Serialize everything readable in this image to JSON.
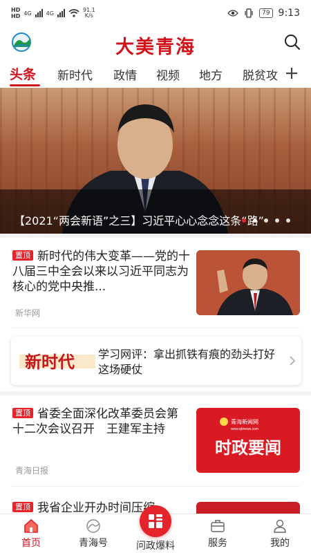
{
  "status_bar": {
    "time": "9:13",
    "battery": "79",
    "net_speed_value": "91.1",
    "net_speed_unit": "K/s",
    "hd1": "HD",
    "hd2": "HD",
    "signal1": "4G",
    "signal2": "4G"
  },
  "header": {
    "brand": "大美青海",
    "logo_icon": "qinghai-logo-icon",
    "search_icon": "search-icon"
  },
  "tabs": {
    "items": [
      "头条",
      "新时代",
      "政情",
      "视频",
      "地方",
      "脱贫攻"
    ],
    "active_index": 0,
    "more_icon": "plus-icon"
  },
  "hero": {
    "caption": "【2021“两会新语”之三】习近平心心念念这条“路”",
    "slides_total": 5,
    "active_slide": 1
  },
  "news": [
    {
      "badge": "置顶",
      "title": "新时代的伟大变革——党的十八届三中全会以来以习近平同志为核心的党中央推...",
      "source": "新华网"
    },
    {
      "badge": "置顶",
      "title": "省委全面深化改革委员会第十二次会议召开　王建军主持",
      "source": "青海日报",
      "thumb_logo": "青海新闻网",
      "thumb_logo_sub": "www.qhnews.com",
      "thumb_text": "时政要闻"
    },
    {
      "badge": "置顶",
      "title": "我省企业开办时间压缩"
    }
  ],
  "promo_card": {
    "logo_text": "新时代",
    "text": "学习网评：拿出抓铁有痕的劲头打好这场硬仗"
  },
  "bottom_nav": {
    "items": [
      {
        "label": "首页",
        "icon": "home-icon"
      },
      {
        "label": "青海号",
        "icon": "qinghai-account-icon"
      },
      {
        "label": "问政爆料",
        "icon": "report-grid-icon"
      },
      {
        "label": "服务",
        "icon": "briefcase-icon"
      },
      {
        "label": "我的",
        "icon": "user-icon"
      }
    ],
    "active_index": 0
  },
  "colors": {
    "brand_red": "#d0121b",
    "accent_red": "#e4232b"
  }
}
